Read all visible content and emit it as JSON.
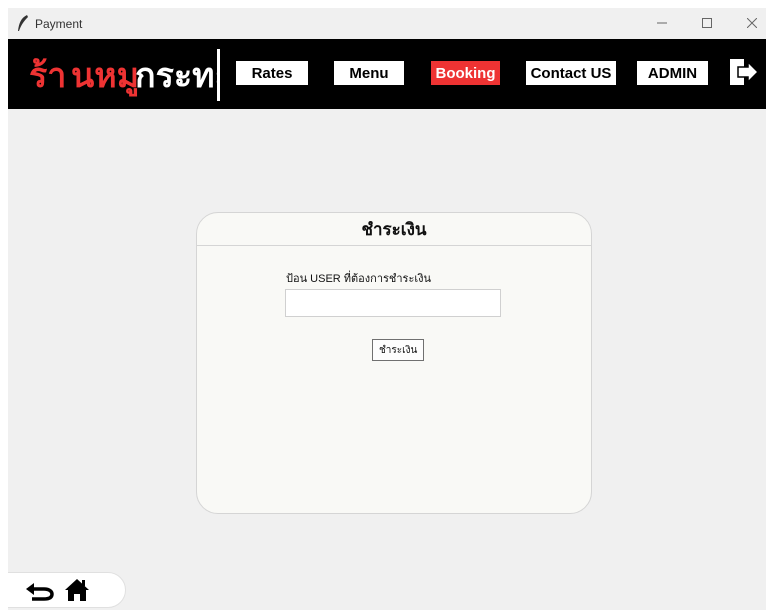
{
  "window": {
    "title": "Payment"
  },
  "brand": {
    "text": "ร้านหมูกระทะ",
    "accent_color": "#ee3333"
  },
  "nav": {
    "items": [
      {
        "label": "Rates"
      },
      {
        "label": "Menu"
      },
      {
        "label": "Booking",
        "active": true
      },
      {
        "label": "Contact US"
      },
      {
        "label": "ADMIN"
      }
    ]
  },
  "payment": {
    "title": "ชำระเงิน",
    "field_label": "ป้อน USER ที่ต้องการชำระเงิน",
    "input_value": "",
    "button_label": "ชำระเงิน"
  },
  "icons": {
    "logout": "logout-icon",
    "back": "back-arrow-icon",
    "home": "home-icon"
  },
  "colors": {
    "navbar": "#000000",
    "active": "#ee3333",
    "background": "#f0f0f0"
  }
}
